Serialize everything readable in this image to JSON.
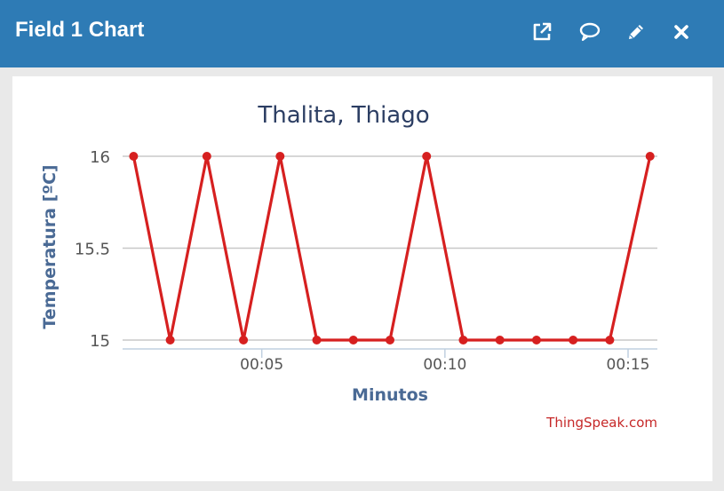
{
  "window": {
    "title": "Field 1 Chart",
    "buttons": [
      {
        "name": "open-external",
        "icon": "external-link-icon"
      },
      {
        "name": "comment",
        "icon": "speech-bubble-icon"
      },
      {
        "name": "edit",
        "icon": "pencil-icon"
      },
      {
        "name": "close",
        "icon": "close-icon"
      }
    ],
    "accent_color": "#2e7bb5"
  },
  "chart_data": {
    "type": "line",
    "title": "Thalita, Thiago",
    "xlabel": "Minutos",
    "ylabel": "Temperatura [ºC]",
    "ylim": [
      15,
      16
    ],
    "y_ticks": [
      "15",
      "15.5",
      "16"
    ],
    "x_ticks": [
      {
        "label": "00:05",
        "value": 5
      },
      {
        "label": "00:10",
        "value": 10
      },
      {
        "label": "00:15",
        "value": 15
      }
    ],
    "xlim": [
      1.2,
      15.8
    ],
    "series": [
      {
        "color": "#d62020",
        "x": [
          1.5,
          2.5,
          3.5,
          4.5,
          5.5,
          6.5,
          7.5,
          8.5,
          9.5,
          10.5,
          11.5,
          12.5,
          13.5,
          14.5,
          15.6
        ],
        "values": [
          16,
          15,
          16,
          15,
          16,
          15,
          15,
          15,
          16,
          15,
          15,
          15,
          15,
          15,
          16
        ]
      }
    ],
    "grid": true,
    "credit": "ThingSpeak.com"
  }
}
